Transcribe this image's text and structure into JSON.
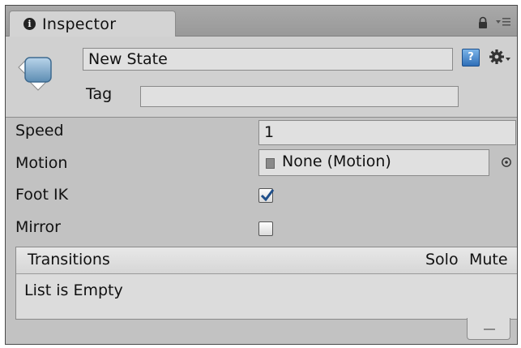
{
  "tab": {
    "title": "Inspector",
    "info_icon_glyph": "i"
  },
  "toolbar": {
    "lock_icon": "lock-icon",
    "menu_icon": "menu-icon"
  },
  "state": {
    "name": "New State",
    "tag_label": "Tag",
    "tag_value": "",
    "help_icon_glyph": "?"
  },
  "properties": {
    "speed_label": "Speed",
    "speed_value": "1",
    "motion_label": "Motion",
    "motion_value": "None (Motion)",
    "foot_ik_label": "Foot IK",
    "foot_ik_checked": true,
    "mirror_label": "Mirror",
    "mirror_checked": false
  },
  "transitions": {
    "title": "Transitions",
    "solo_label": "Solo",
    "mute_label": "Mute",
    "empty_text": "List is Empty",
    "remove_label": "–"
  },
  "colors": {
    "panel_bg": "#c2c2c2",
    "header_bg": "#d0d0d0",
    "field_bg": "#e0e0e0",
    "check_color": "#1f4f8a"
  }
}
